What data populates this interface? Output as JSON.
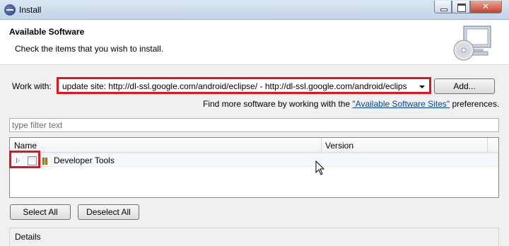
{
  "window": {
    "title": "Install"
  },
  "banner": {
    "heading": "Available Software",
    "subtitle": "Check the items that you wish to install."
  },
  "workwith": {
    "label": "Work with:",
    "value": "update site: http://dl-ssl.google.com/android/eclipse/ - http://dl-ssl.google.com/android/eclips",
    "add_label": "Add..."
  },
  "findmore": {
    "prefix": "Find more software by working with the ",
    "link": "\"Available Software Sites\"",
    "suffix": " preferences."
  },
  "filter": {
    "placeholder": "type filter text"
  },
  "table": {
    "columns": [
      "Name",
      "Version"
    ],
    "rows": [
      {
        "name": "Developer Tools",
        "version": "",
        "checked": false
      }
    ]
  },
  "buttons": {
    "select_all": "Select All",
    "deselect_all": "Deselect All"
  },
  "details": {
    "label": "Details"
  },
  "colors": {
    "highlight": "#e0141a",
    "link": "#0645ad"
  }
}
